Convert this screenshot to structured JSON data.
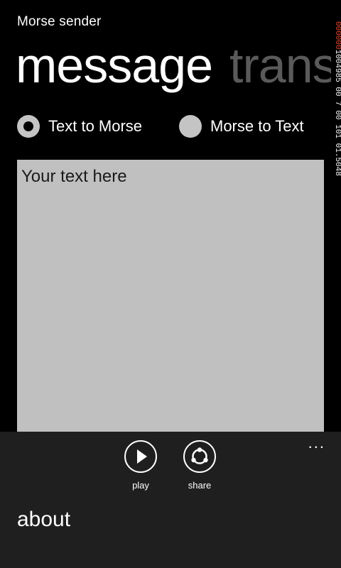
{
  "app": {
    "title": "Morse sender"
  },
  "pivot": {
    "items": [
      "message",
      "trans"
    ]
  },
  "mode": {
    "options": [
      "Text to Morse",
      "Morse to Text"
    ],
    "selected": "Text to Morse"
  },
  "editor": {
    "text": "Your text here"
  },
  "side_strip": {
    "accent": "000000",
    "text": "1004985 00 7 00 101 01.5048"
  },
  "appbar": {
    "more": "...",
    "buttons": [
      {
        "label": "play",
        "icon": "play-icon"
      },
      {
        "label": "share",
        "icon": "share-icon"
      }
    ],
    "menu": [
      "about"
    ]
  },
  "colors": {
    "background": "#000000",
    "appbar": "#1f1f1f",
    "input": "#c0c0c0",
    "radio": "#c4c4c4",
    "inactive_pivot": "#5a5a5a",
    "strip_accent": "#e8452c"
  }
}
